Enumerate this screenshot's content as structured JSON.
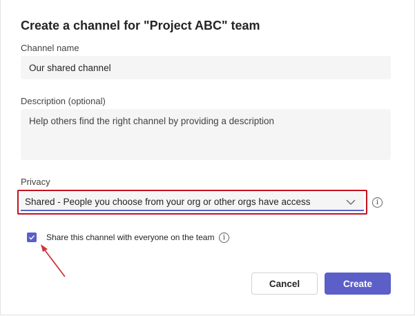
{
  "dialog": {
    "title": "Create a channel for \"Project ABC\" team"
  },
  "channel_name": {
    "label": "Channel name",
    "value": "Our shared channel"
  },
  "description": {
    "label": "Description (optional)",
    "placeholder": "Help others find the right channel by providing a description"
  },
  "privacy": {
    "label": "Privacy",
    "selected": "Shared - People you choose from your org or other orgs have access",
    "info_icon": "info-icon"
  },
  "share_option": {
    "label": "Share this channel with everyone on the team",
    "checked": true
  },
  "buttons": {
    "cancel": "Cancel",
    "create": "Create"
  },
  "colors": {
    "accent": "#5b5fc7",
    "highlight": "#c50f1f",
    "field_bg": "#f5f5f5"
  }
}
